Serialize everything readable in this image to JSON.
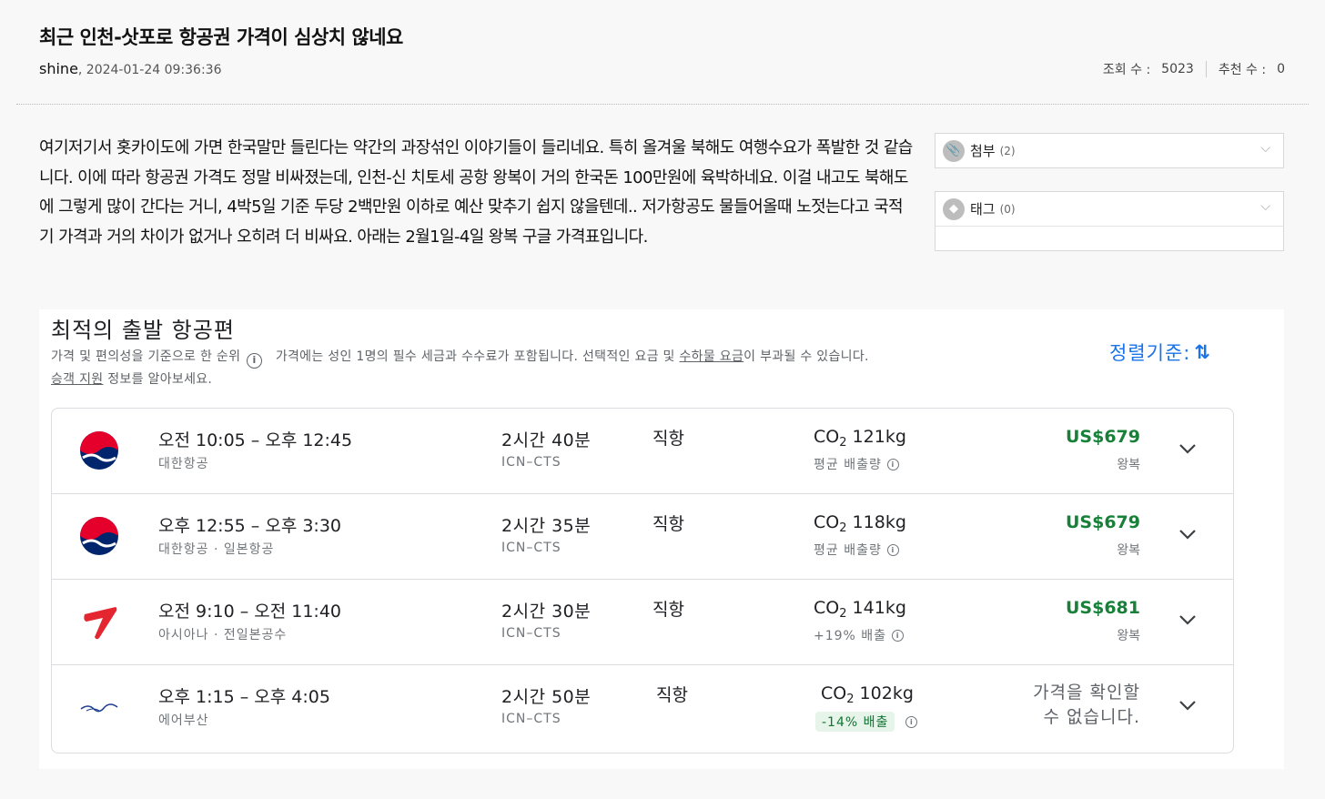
{
  "post": {
    "title": "최근 인천-삿포로 항공권 가격이 심상치 않네요",
    "author": "shine",
    "date": ", 2024-01-24 09:36:36",
    "views_label": "조회 수 :",
    "views": "5023",
    "recommend_label": "추천 수 :",
    "recommend": "0",
    "body": "여기저기서 홋카이도에 가면 한국말만 들린다는 약간의 과장섞인 이야기들이 들리네요. 특히 올겨울 북해도 여행수요가 폭발한 것 같습니다. 이에 따라 항공권 가격도 정말 비싸졌는데, 인천-신 치토세 공항 왕복이 거의 한국돈 100만원에 육박하네요. 이걸 내고도 북해도에 그렇게 많이 간다는 거니, 4박5일 기준 두당 2백만원 이하로 예산 맞추기 쉽지 않을텐데.. 저가항공도 물들어올때 노젓는다고 국적기 가격과 거의 차이가 없거나 오히려 더 비싸요. 아래는 2월1일-4일 왕복 구글 가격표입니다."
  },
  "sidebar": {
    "attach_label": "첨부",
    "attach_count": "(2)",
    "tag_label": "태그",
    "tag_count": "(0)"
  },
  "flights": {
    "title": "최적의 출발 항공편",
    "sub_a": "가격 및 편의성을 기준으로 한 순위",
    "sub_b": "가격에는 성인 1명의 필수 세금과 수수료가 포함됩니다. 선택적인 요금 및 ",
    "sub_link1": "수하물 요금",
    "sub_c": "이 부과될 수 있습니다.",
    "sub_link2": "승객 지원",
    "sub_d": " 정보를 알아보세요.",
    "sort_label": "정렬기준:",
    "co2_prefix": "CO",
    "co2_sub": "2",
    "rows": [
      {
        "times": "오전 10:05 – 오후 12:45",
        "airline": "대한항공",
        "duration": "2시간 40분",
        "route": "ICN–CTS",
        "stops": "직항",
        "co2": " 121kg",
        "emission": "평균 배출량",
        "price": "US$679",
        "trip": "왕복"
      },
      {
        "times": "오후 12:55 – 오후 3:30",
        "airline": "대한항공 · 일본항공",
        "duration": "2시간 35분",
        "route": "ICN–CTS",
        "stops": "직항",
        "co2": " 118kg",
        "emission": "평균 배출량",
        "price": "US$679",
        "trip": "왕복"
      },
      {
        "times": "오전 9:10 – 오전 11:40",
        "airline": "아시아나 · 전일본공수",
        "duration": "2시간 30분",
        "route": "ICN–CTS",
        "stops": "직항",
        "co2": " 141kg",
        "emission": "+19% 배출",
        "price": "US$681",
        "trip": "왕복"
      },
      {
        "times": "오후 1:15 – 오후 4:05",
        "airline": "에어부산",
        "duration": "2시간 50분",
        "route": "ICN–CTS",
        "stops": "직항",
        "co2": " 102kg",
        "emission": "-14% 배출",
        "price_na_1": "가격을 확인할",
        "price_na_2": "수 없습니다."
      }
    ]
  },
  "colors": {
    "korean_air_red": "#e4002b",
    "korean_air_blue": "#00256c",
    "asiana_red": "#e3262f",
    "price_green": "#188038",
    "link_blue": "#1a73e8"
  }
}
